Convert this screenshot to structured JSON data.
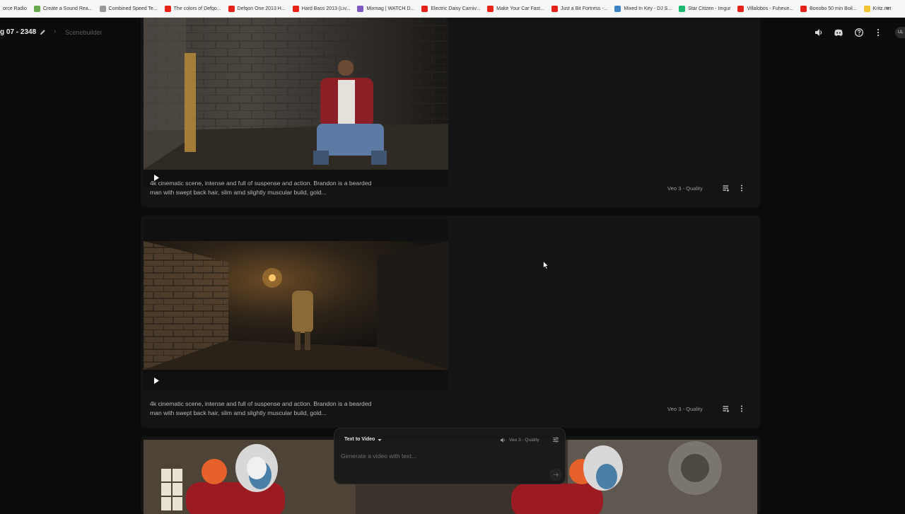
{
  "bookmarks": [
    {
      "label": "orce Radio",
      "color": "#ffffff"
    },
    {
      "label": "Create a Sound Rea...",
      "color": "#6aa84f"
    },
    {
      "label": "Combined Speed Te...",
      "color": "#999999"
    },
    {
      "label": "The colors of Defqo...",
      "color": "#e62117"
    },
    {
      "label": "Defqon One 2013 H...",
      "color": "#e62117"
    },
    {
      "label": "Hard Bass 2013 (Liv...",
      "color": "#e62117"
    },
    {
      "label": "Mixmag | WATCH D...",
      "color": "#7e57c2"
    },
    {
      "label": "Electric Daisy Carniv...",
      "color": "#e62117"
    },
    {
      "label": "Make Your Car Fast...",
      "color": "#e62117"
    },
    {
      "label": "Just a Bit Fortress -...",
      "color": "#e62117"
    },
    {
      "label": "Mixed In Key - DJ S...",
      "color": "#3d85c6"
    },
    {
      "label": "Star Citizen - Imgur",
      "color": "#1bb76e"
    },
    {
      "label": "Villalobos - Fuheue...",
      "color": "#e62117"
    },
    {
      "label": "Bonobo 50 min Boil...",
      "color": "#e62117"
    },
    {
      "label": "Kritz.net",
      "color": "#f1c232"
    }
  ],
  "bookmarks_more": "»",
  "header": {
    "project_title": "g 07 - 2348",
    "breadcrumb_sep": "›",
    "breadcrumb_current": "Scenebuilder",
    "avatar_initials": "UL"
  },
  "scenes": [
    {
      "prompt": "4k cinematic scene, intense and full of suspense and action. Brandon is a bearded man with swept back hair, slim amd slightly muscular build, gold...",
      "model": "Veo 3 - Quality"
    },
    {
      "prompt": "4k cinematic scene, intense and full of suspense and action. Brandon is a bearded man with swept back hair, slim amd slightly muscular build, gold...",
      "model": "Veo 3 - Quality"
    }
  ],
  "composer": {
    "mode": "Text to Video",
    "model": "Veo 3 - Quality",
    "placeholder": "Generate a video with text..."
  },
  "colors": {
    "background": "#0b0b0b",
    "card": "#141414",
    "composer": "#181818"
  }
}
